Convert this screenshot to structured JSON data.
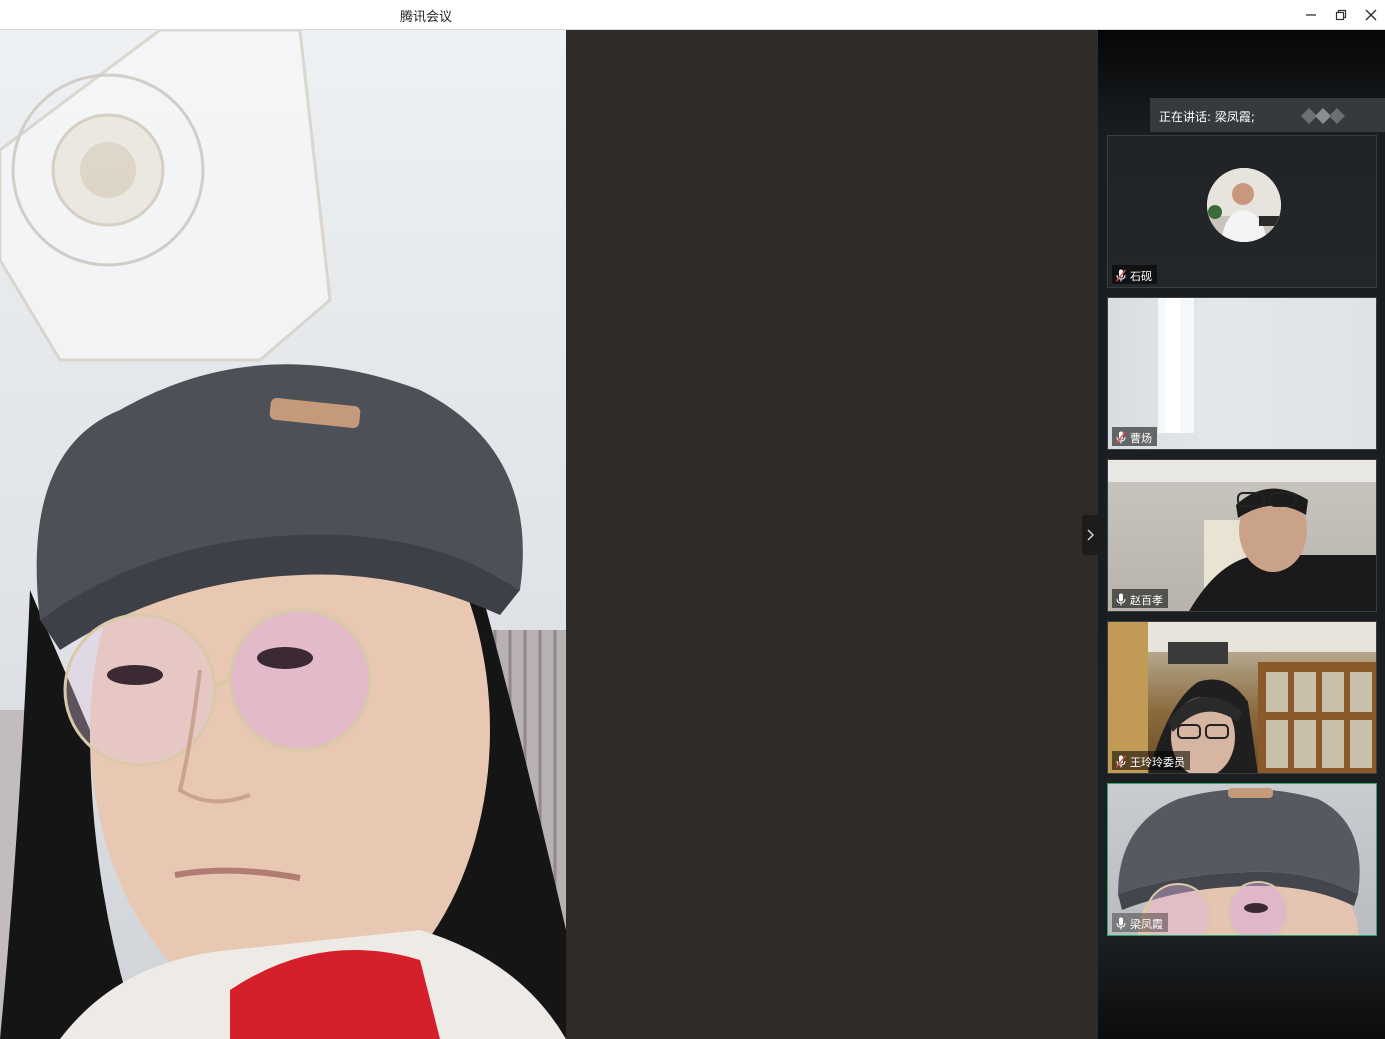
{
  "window": {
    "title": "腾讯会议",
    "minimize_icon": "minimize-icon",
    "maximize_icon": "restore-icon",
    "close_icon": "close-icon"
  },
  "speaking": {
    "text": "正在讲话: 梁凤霞;"
  },
  "participants": [
    {
      "name": "石砚",
      "mic": "muted",
      "video": "avatar"
    },
    {
      "name": "曹炀",
      "mic": "muted",
      "video": "on"
    },
    {
      "name": "赵百孝",
      "mic": "unmuted",
      "video": "on"
    },
    {
      "name": "王玲玲委员",
      "mic": "muted",
      "video": "on"
    },
    {
      "name": "梁凤霞",
      "mic": "unmuted",
      "video": "on",
      "active": true
    }
  ],
  "colors": {
    "stage_bg": "#2e2b29",
    "sidebar_bg": "#1c1f22",
    "active_border": "#2ea36b",
    "muted_mic": "#e05050"
  }
}
